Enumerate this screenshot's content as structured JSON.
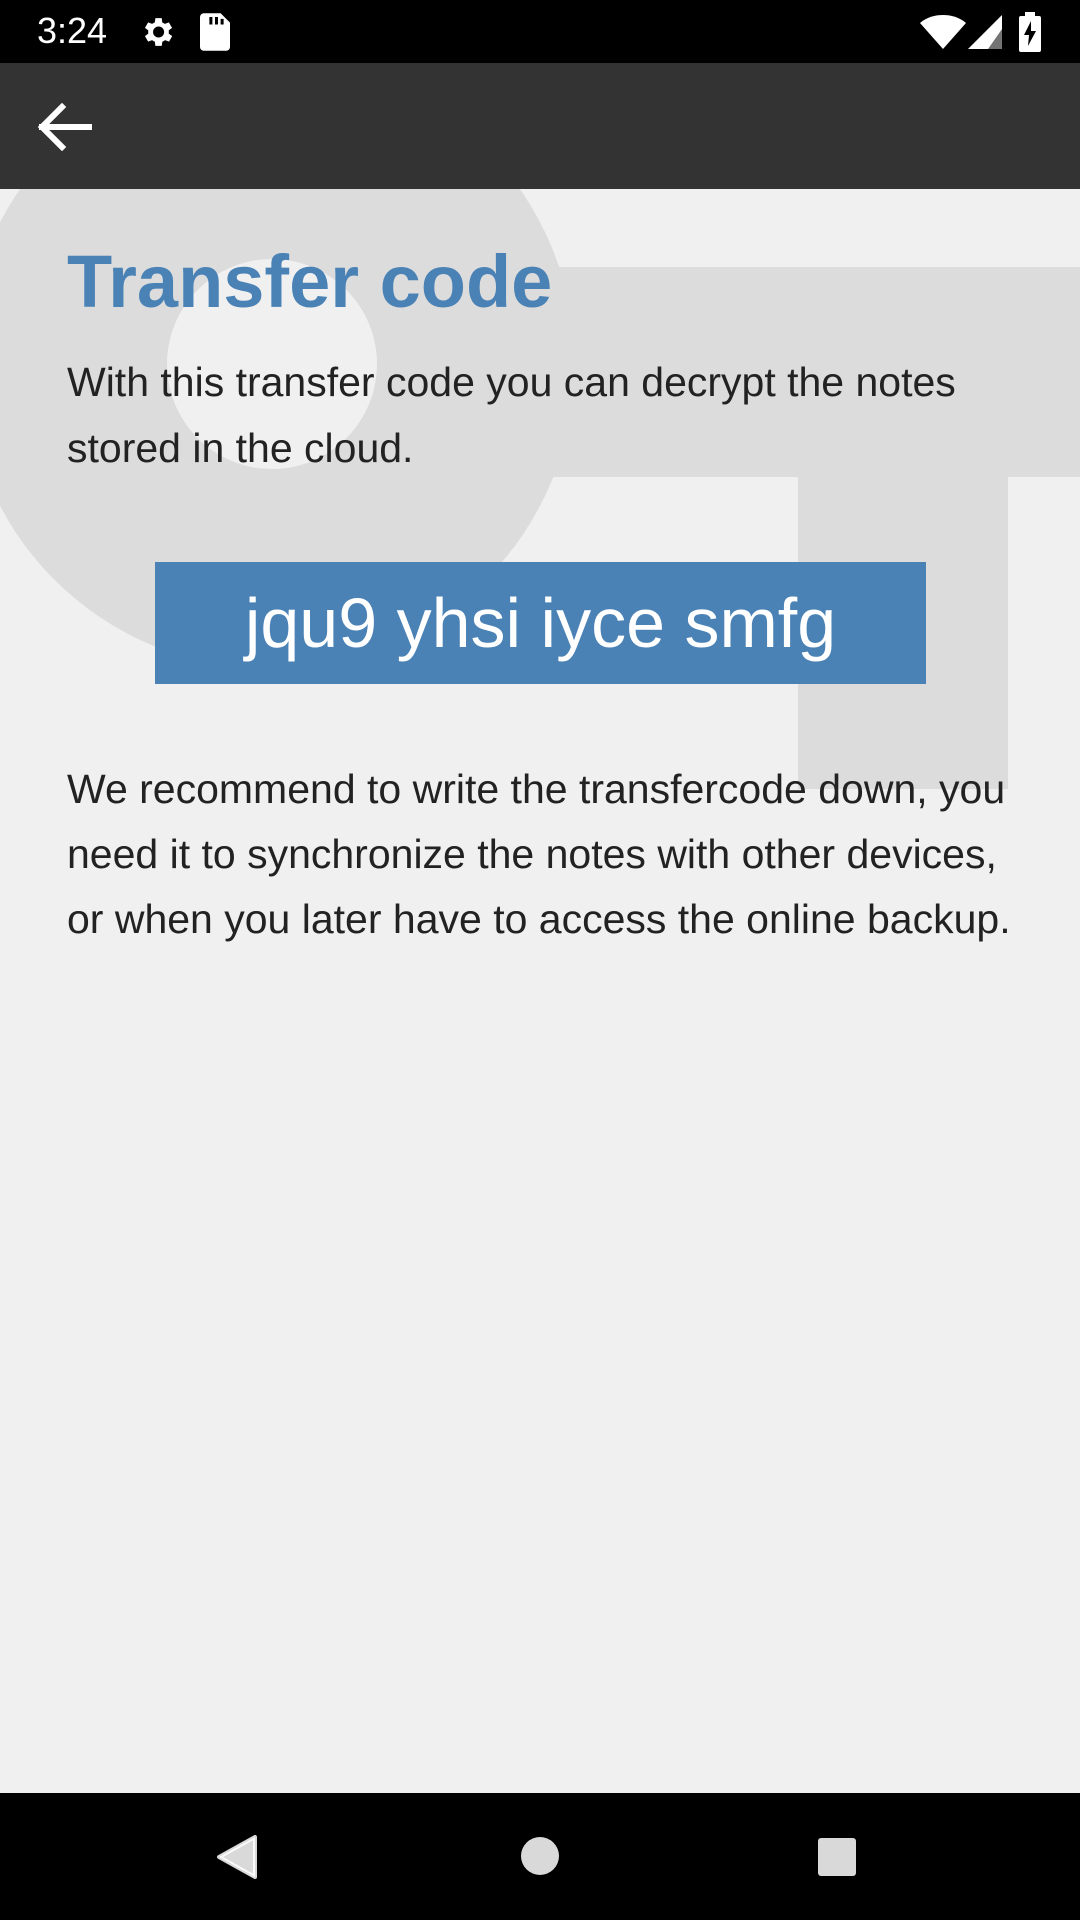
{
  "status_bar": {
    "time": "3:24",
    "icons": [
      "gear-icon",
      "sd-card-icon",
      "wifi-icon",
      "signal-icon",
      "battery-charging-icon"
    ]
  },
  "app_bar": {
    "back_icon": "arrow-back-icon"
  },
  "main": {
    "title": "Transfer code",
    "intro": "With this transfer code you can decrypt the notes stored in the cloud.",
    "code": "jqu9 yhsi iyce smfg",
    "recommendation": "We recommend to write the transfercode down, you need it to synchronize the notes with other devices, or when you later have to access the online backup."
  },
  "nav_bar": {
    "icons": [
      "nav-back-icon",
      "nav-home-icon",
      "nav-recents-icon"
    ]
  },
  "colors": {
    "accent": "#4a82b6",
    "app_bar": "#333333",
    "background": "#f0f0f0",
    "key_watermark": "#dcdcdc"
  }
}
